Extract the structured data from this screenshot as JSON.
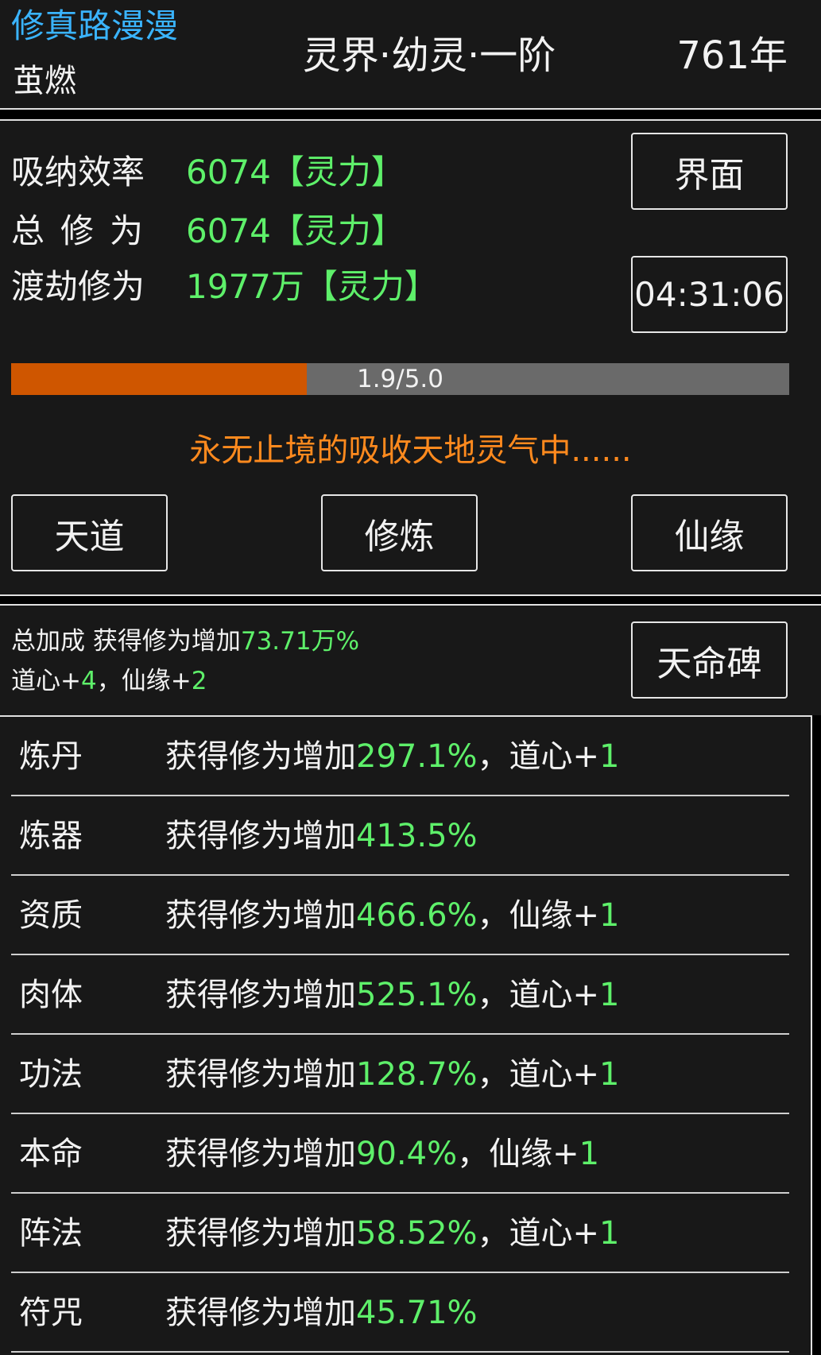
{
  "header": {
    "game_title": "修真路漫漫",
    "player_name": "茧燃",
    "realm": "灵界·幼灵·一阶",
    "age": "761年"
  },
  "stats": {
    "absorb_label": "吸纳效率",
    "absorb_value": "6074【灵力】",
    "total_label": "总修为",
    "total_value": "6074【灵力】",
    "tribulation_label": "渡劫修为",
    "tribulation_value": "1977万【灵力】"
  },
  "buttons": {
    "interface": "界面",
    "timer": "04:31:06",
    "tiandao": "天道",
    "cultivate": "修炼",
    "xianyuan": "仙缘",
    "tianmingbei": "天命碑"
  },
  "progress": {
    "text": "1.9/5.0",
    "fraction": 0.38,
    "fill_color": "#cf5600",
    "track_color": "#6a6a6a"
  },
  "status_message": "永无止境的吸收天地灵气中......",
  "bonus": {
    "line1_prefix": "总加成 获得修为增加",
    "line1_value": "73.71万%",
    "line2_a": "道心+",
    "line2_a_val": "4",
    "line2_sep": "，仙缘+",
    "line2_b_val": "2"
  },
  "skills": [
    {
      "name": "炼丹",
      "effect_prefix": "获得修为增加",
      "percent": "297.1%",
      "extra": "，道心+",
      "extra_val": "1"
    },
    {
      "name": "炼器",
      "effect_prefix": "获得修为增加",
      "percent": "413.5%",
      "extra": "",
      "extra_val": ""
    },
    {
      "name": "资质",
      "effect_prefix": "获得修为增加",
      "percent": "466.6%",
      "extra": "，仙缘+",
      "extra_val": "1"
    },
    {
      "name": "肉体",
      "effect_prefix": "获得修为增加",
      "percent": "525.1%",
      "extra": "，道心+",
      "extra_val": "1"
    },
    {
      "name": "功法",
      "effect_prefix": "获得修为增加",
      "percent": "128.7%",
      "extra": "，道心+",
      "extra_val": "1"
    },
    {
      "name": "本命",
      "effect_prefix": "获得修为增加",
      "percent": "90.4%",
      "extra": "，仙缘+",
      "extra_val": "1"
    },
    {
      "name": "阵法",
      "effect_prefix": "获得修为增加",
      "percent": "58.52%",
      "extra": "，道心+",
      "extra_val": "1"
    },
    {
      "name": "符咒",
      "effect_prefix": "获得修为增加",
      "percent": "45.71%",
      "extra": "",
      "extra_val": ""
    }
  ],
  "colors": {
    "accent_blue": "#3ab4ff",
    "value_green": "#5ef06a",
    "status_orange": "#ff8a1e",
    "panel_bg": "#181818"
  }
}
